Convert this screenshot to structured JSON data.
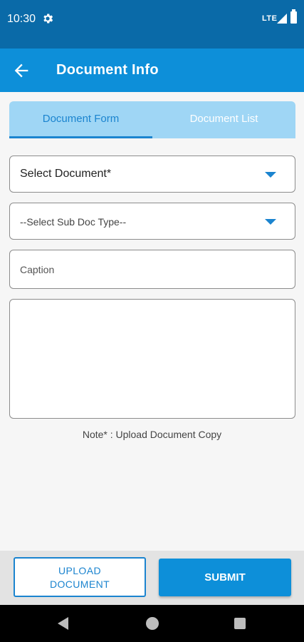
{
  "status_bar": {
    "time": "10:30",
    "network": "LTE",
    "icons": [
      "gear-icon",
      "signal-icon",
      "battery-icon"
    ]
  },
  "app_bar": {
    "title": "Document Info",
    "back_icon": "arrow-left-icon"
  },
  "tabs": [
    {
      "label": "Document Form",
      "active": true
    },
    {
      "label": "Document List",
      "active": false
    }
  ],
  "form": {
    "select_document": "Select Document*",
    "select_sub_doc_type": "--Select Sub Doc Type--",
    "caption_placeholder": "Caption",
    "description_value": ""
  },
  "note": "Note* : Upload Document Copy",
  "buttons": {
    "upload_line1": "UPLOAD",
    "upload_line2": "DOCUMENT",
    "submit": "SUBMIT"
  },
  "colors": {
    "status_bar": "#0a6aa8",
    "app_bar": "#0d8fd9",
    "tab_strip": "#9fd6f5",
    "accent": "#1b84cf"
  }
}
